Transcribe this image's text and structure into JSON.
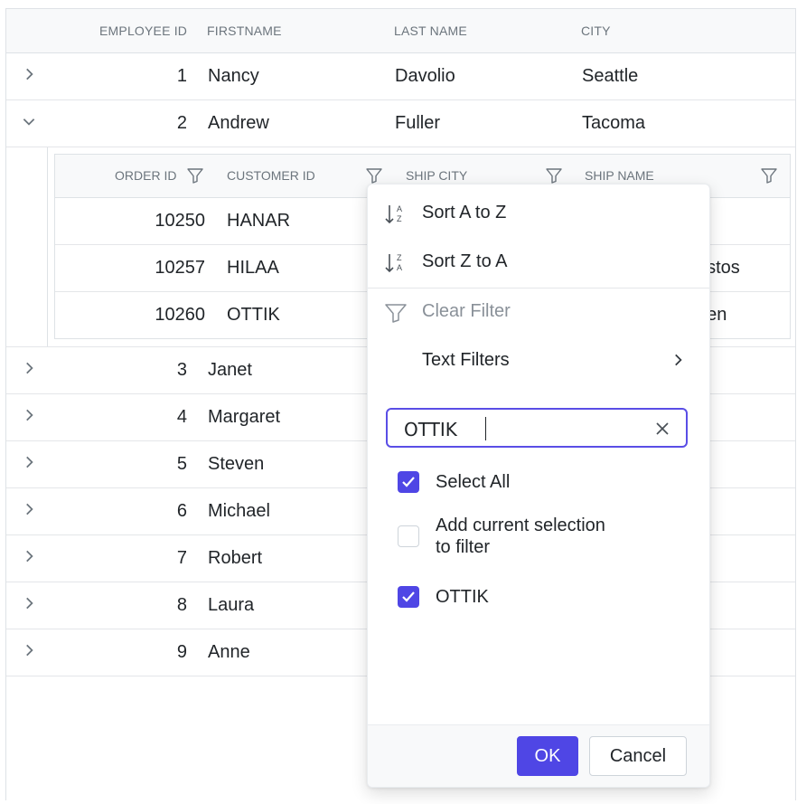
{
  "columns": {
    "employee_id": "EMPLOYEE ID",
    "first_name": "FIRSTNAME",
    "last_name": "LAST NAME",
    "city": "CITY"
  },
  "employees": [
    {
      "id": "1",
      "first": "Nancy",
      "last": "Davolio",
      "city": "Seattle"
    },
    {
      "id": "2",
      "first": "Andrew",
      "last": "Fuller",
      "city": "Tacoma"
    },
    {
      "id": "3",
      "first": "Janet",
      "last": "",
      "city": ""
    },
    {
      "id": "4",
      "first": "Margaret",
      "last": "",
      "city": ""
    },
    {
      "id": "5",
      "first": "Steven",
      "last": "",
      "city": ""
    },
    {
      "id": "6",
      "first": "Michael",
      "last": "",
      "city": ""
    },
    {
      "id": "7",
      "first": "Robert",
      "last": "",
      "city": ""
    },
    {
      "id": "8",
      "first": "Laura",
      "last": "",
      "city": ""
    },
    {
      "id": "9",
      "first": "Anne",
      "last": "",
      "city": ""
    }
  ],
  "child_columns": {
    "order_id": "ORDER ID",
    "customer_id": "CUSTOMER ID",
    "ship_city": "SHIP CITY",
    "ship_name": "SHIP NAME"
  },
  "orders": [
    {
      "order_id": "10250",
      "customer_id": "HANAR",
      "ship_name_visible": ""
    },
    {
      "order_id": "10257",
      "customer_id": "HILAA",
      "ship_name_visible": "astos"
    },
    {
      "order_id": "10260",
      "customer_id": "OTTIK",
      "ship_name_visible": "den"
    }
  ],
  "filter_menu": {
    "sort_asc": "Sort A to Z",
    "sort_desc": "Sort Z to A",
    "clear_filter": "Clear Filter",
    "text_filters": "Text Filters",
    "search_value": "OTTIK",
    "select_all": "Select All",
    "add_selection": "Add current selection",
    "add_selection_2": "to filter",
    "option_1": "OTTIK",
    "ok": "OK",
    "cancel": "Cancel"
  },
  "colors": {
    "accent": "#4f46e5",
    "header_bg": "#f8f9fa",
    "border": "#dee2e6",
    "muted_text": "#6c757d"
  },
  "icons": [
    "chevron-right-icon",
    "chevron-down-icon",
    "filter-icon",
    "sort-ascending-icon",
    "sort-descending-icon",
    "clear-filter-icon",
    "close-icon",
    "checkmark-icon"
  ]
}
